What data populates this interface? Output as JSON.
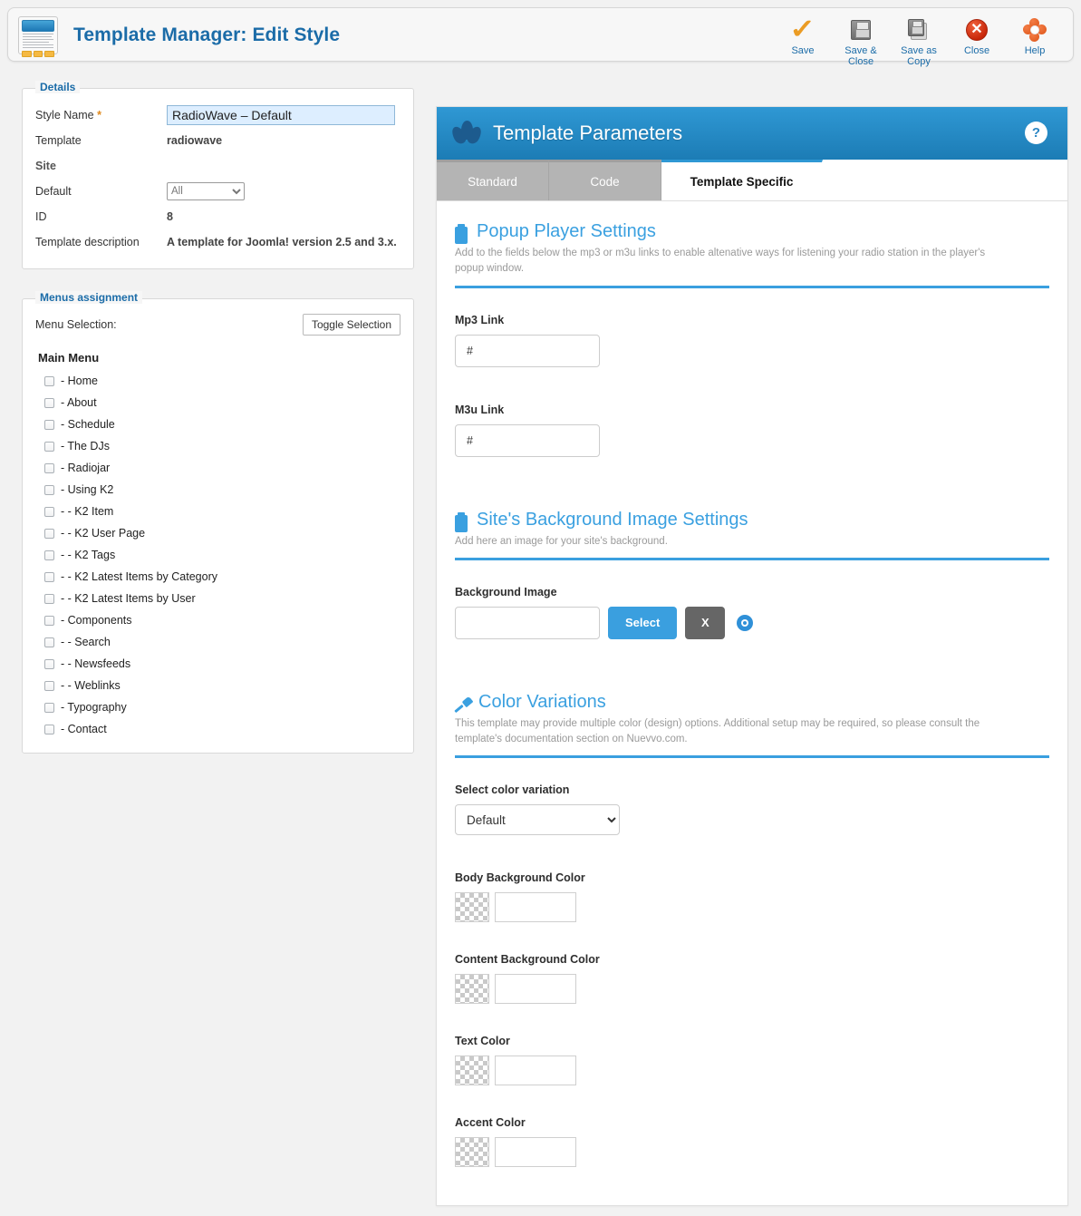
{
  "header": {
    "title": "Template Manager: Edit Style",
    "logo_icon": "template-mockup-icon"
  },
  "toolbar": {
    "buttons": [
      {
        "label": "Save",
        "icon": "checkmark-icon"
      },
      {
        "label": "Save & Close",
        "icon": "floppy-disk-icon"
      },
      {
        "label": "Save as Copy",
        "icon": "floppy-disk-copy-icon"
      },
      {
        "label": "Close",
        "icon": "red-x-circle-icon"
      },
      {
        "label": "Help",
        "icon": "lifebuoy-icon"
      }
    ]
  },
  "details": {
    "legend": "Details",
    "style_name_label": "Style Name",
    "style_name_required": "*",
    "style_name_value": "RadioWave – Default",
    "template_label": "Template",
    "template_value": "radiowave",
    "site_label": "Site",
    "default_label": "Default",
    "default_value": "All",
    "default_options": [
      "All"
    ],
    "id_label": "ID",
    "id_value": "8",
    "description_label": "Template description",
    "description_value": "A template for Joomla! version 2.5 and 3.x."
  },
  "menus": {
    "legend": "Menus assignment",
    "selection_label": "Menu Selection:",
    "toggle_button": "Toggle Selection",
    "menu_title": "Main Menu",
    "items": [
      {
        "label": "- Home",
        "checked": false
      },
      {
        "label": "- About",
        "checked": false
      },
      {
        "label": "- Schedule",
        "checked": false
      },
      {
        "label": "- The DJs",
        "checked": false
      },
      {
        "label": "- Radiojar",
        "checked": false
      },
      {
        "label": "- Using K2",
        "checked": false
      },
      {
        "label": "- - K2 Item",
        "checked": false
      },
      {
        "label": "- - K2 User Page",
        "checked": false
      },
      {
        "label": "- - K2 Tags",
        "checked": false
      },
      {
        "label": "- - K2 Latest Items by Category",
        "checked": false
      },
      {
        "label": "- - K2 Latest Items by User",
        "checked": false
      },
      {
        "label": "- Components",
        "checked": false
      },
      {
        "label": "- - Search",
        "checked": false
      },
      {
        "label": "- - Newsfeeds",
        "checked": false
      },
      {
        "label": "- - Weblinks",
        "checked": false
      },
      {
        "label": "- Typography",
        "checked": false
      },
      {
        "label": "- Contact",
        "checked": false
      }
    ]
  },
  "params": {
    "panel_title": "Template Parameters",
    "help_glyph": "?",
    "logo_icon": "lotus-flower-icon",
    "tabs": [
      {
        "label": "Standard",
        "active": false
      },
      {
        "label": "Code",
        "active": false
      },
      {
        "label": "Template Specific",
        "active": true
      }
    ],
    "sections": [
      {
        "icon": "clipboard-icon",
        "title": "Popup Player Settings",
        "description": "Add to the fields below the mp3 or m3u links to enable altenative ways for listening your radio station in the player's popup window.",
        "fields": [
          {
            "label": "Mp3 Link",
            "value": "#"
          },
          {
            "label": "M3u Link",
            "value": "#"
          }
        ]
      },
      {
        "icon": "clipboard-icon",
        "title": "Site's Background Image Settings",
        "description": "Add here an image for your site's background.",
        "bg_field_label": "Background Image",
        "bg_field_value": "",
        "select_button": "Select",
        "clear_button": "X",
        "preview_icon": "eye-icon"
      },
      {
        "icon": "paintbrush-icon",
        "title": "Color Variations",
        "description": "This template may provide multiple color (design) options. Additional setup may be required, so please consult the template's documentation section on Nuevvo.com.",
        "variation_label": "Select color variation",
        "variation_value": "Default",
        "variation_options": [
          "Default"
        ],
        "colors": [
          {
            "label": "Body Background Color",
            "value": ""
          },
          {
            "label": "Content Background Color",
            "value": ""
          },
          {
            "label": "Text Color",
            "value": ""
          },
          {
            "label": "Accent Color",
            "value": ""
          }
        ]
      }
    ]
  },
  "theme": {
    "accent_blue": "#3a9fdf",
    "header_blue": "#1c7cb5",
    "title_blue": "#1b6ca8",
    "save_orange": "#eb9c24",
    "close_red": "#c62407",
    "highlight_field": "#ddeeff"
  }
}
